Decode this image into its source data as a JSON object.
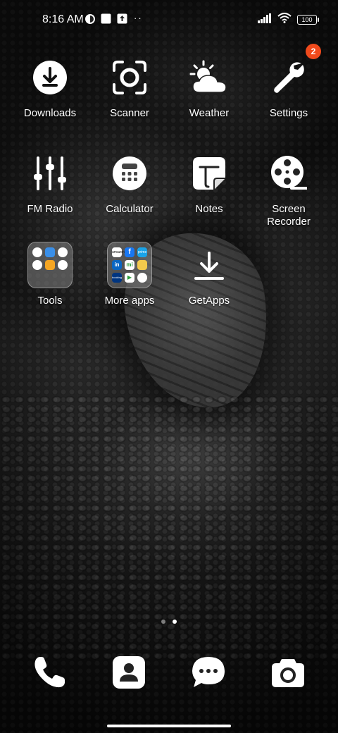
{
  "status_bar": {
    "time": "8:16 AM",
    "battery": "100"
  },
  "apps": [
    {
      "name": "Downloads",
      "label": "Downloads",
      "icon": "download-icon"
    },
    {
      "name": "Scanner",
      "label": "Scanner",
      "icon": "scanner-icon"
    },
    {
      "name": "Weather",
      "label": "Weather",
      "icon": "weather-icon"
    },
    {
      "name": "Settings",
      "label": "Settings",
      "icon": "wrench-icon",
      "badge": "2"
    },
    {
      "name": "FM Radio",
      "label": "FM Radio",
      "icon": "equalizer-icon"
    },
    {
      "name": "Calculator",
      "label": "Calculator",
      "icon": "calculator-icon"
    },
    {
      "name": "Notes",
      "label": "Notes",
      "icon": "notes-icon"
    },
    {
      "name": "Screen Recorder",
      "label_line1": "Screen",
      "label_line2": "Recorder",
      "icon": "film-reel-icon"
    },
    {
      "name": "Tools",
      "label": "Tools",
      "icon": "folder-icon"
    },
    {
      "name": "More apps",
      "label": "More apps",
      "icon": "folder-icon"
    },
    {
      "name": "GetApps",
      "label": "GetApps",
      "icon": "download-arrow-icon"
    }
  ],
  "folder_tools": {
    "mini_icons": [
      "#ffffff",
      "#3a8fe8",
      "#ffffff",
      "#ffffff",
      "#f5a623",
      "#ffffff"
    ]
  },
  "folder_more": {
    "mini_labels": [
      "amazon",
      "f",
      "prime",
      "in",
      "mi",
      "",
      "booking",
      "▶",
      ""
    ],
    "mini_colors": [
      "#ffffff",
      "#1877f2",
      "#1aa3e8",
      "#0a66c2",
      "#ffffff",
      "#f2c94c",
      "#003580",
      "#ffffff",
      "#ffffff"
    ]
  },
  "page_indicator": {
    "pages": 2,
    "active": 2
  },
  "dock": [
    {
      "name": "Phone",
      "icon": "phone-icon"
    },
    {
      "name": "Contacts",
      "icon": "contacts-icon"
    },
    {
      "name": "Messages",
      "icon": "message-icon"
    },
    {
      "name": "Camera",
      "icon": "camera-icon"
    }
  ]
}
